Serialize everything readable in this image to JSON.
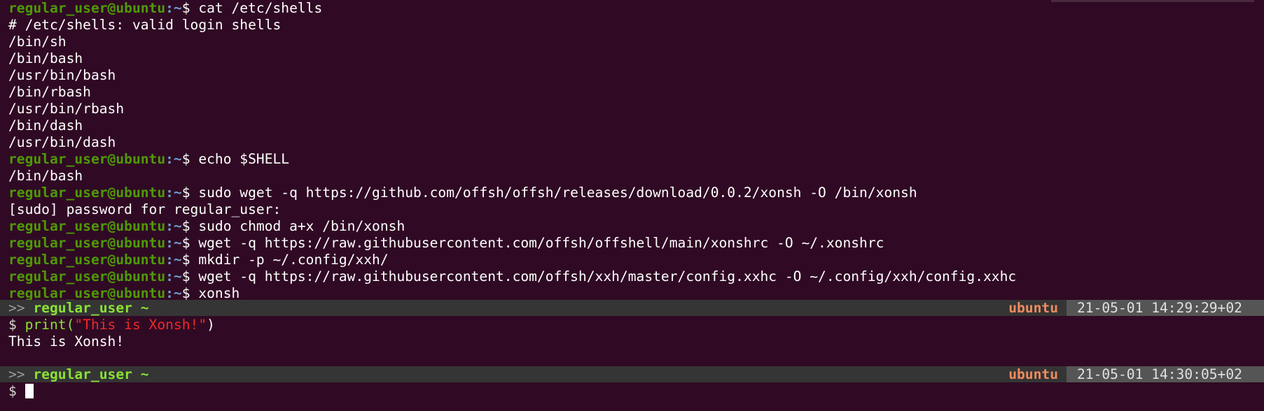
{
  "prompt": {
    "user_host": "regular_user@ubuntu",
    "path_sep": ":~",
    "symbol": "$ "
  },
  "commands": {
    "c1": "cat /etc/shells",
    "c2": "echo $SHELL",
    "c3": "sudo wget -q https://github.com/offsh/offsh/releases/download/0.0.2/xonsh -O /bin/xonsh",
    "c4": "sudo chmod a+x /bin/xonsh",
    "c5": "wget -q https://raw.githubusercontent.com/offsh/offshell/main/xonshrc -O ~/.xonshrc",
    "c6": "mkdir -p ~/.config/xxh/",
    "c7": "wget -q https://raw.githubusercontent.com/offsh/xxh/master/config.xxhc -O ~/.config/xxh/config.xxhc",
    "c8": "xonsh"
  },
  "output": {
    "shells_header": "# /etc/shells: valid login shells",
    "shells": [
      "/bin/sh",
      "/bin/bash",
      "/usr/bin/bash",
      "/bin/rbash",
      "/usr/bin/rbash",
      "/bin/dash",
      "/usr/bin/dash"
    ],
    "shell_value": "/bin/bash",
    "sudo_prompt": "[sudo] password for regular_user:"
  },
  "xonsh": {
    "bar1": {
      "arrows": ">> ",
      "user": "regular_user ~",
      "host": "ubuntu",
      "datetime": "21-05-01 14:29:29+02"
    },
    "bar2": {
      "arrows": ">> ",
      "user": "regular_user ~",
      "host": "ubuntu",
      "datetime": "21-05-01 14:30:05+02"
    },
    "prompt_symbol": "$ ",
    "code_fn": "print(",
    "code_str": "\"This is Xonsh!\"",
    "code_close": ")",
    "result": "This is Xonsh!"
  }
}
